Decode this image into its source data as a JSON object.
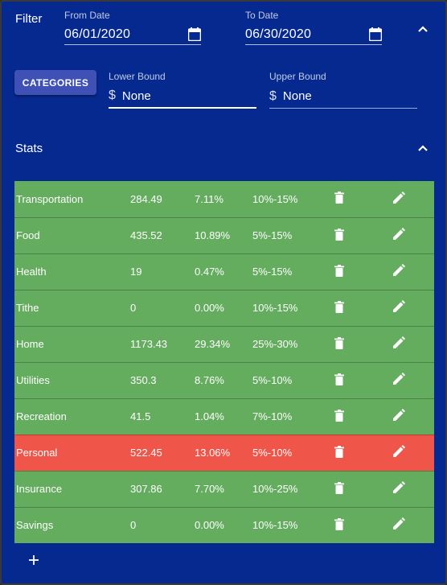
{
  "filter": {
    "title": "Filter",
    "from_date": {
      "label": "From Date",
      "value": "06/01/2020"
    },
    "to_date": {
      "label": "To Date",
      "value": "06/30/2020"
    },
    "categories_button": "CATEGORIES",
    "lower_bound": {
      "label": "Lower Bound",
      "prefix": "$",
      "value": "None"
    },
    "upper_bound": {
      "label": "Upper Bound",
      "prefix": "$",
      "value": "None"
    }
  },
  "stats": {
    "title": "Stats",
    "rows": [
      {
        "name": "Transportation",
        "amount": "284.49",
        "percent": "7.11%",
        "range": "10%-15%",
        "status": "ok"
      },
      {
        "name": "Food",
        "amount": "435.52",
        "percent": "10.89%",
        "range": "5%-15%",
        "status": "ok"
      },
      {
        "name": "Health",
        "amount": "19",
        "percent": "0.47%",
        "range": "5%-15%",
        "status": "ok"
      },
      {
        "name": "Tithe",
        "amount": "0",
        "percent": "0.00%",
        "range": "10%-15%",
        "status": "ok"
      },
      {
        "name": "Home",
        "amount": "1173.43",
        "percent": "29.34%",
        "range": "25%-30%",
        "status": "ok"
      },
      {
        "name": "Utilities",
        "amount": "350.3",
        "percent": "8.76%",
        "range": "5%-10%",
        "status": "ok"
      },
      {
        "name": "Recreation",
        "amount": "41.5",
        "percent": "1.04%",
        "range": "7%-10%",
        "status": "ok"
      },
      {
        "name": "Personal",
        "amount": "522.45",
        "percent": "13.06%",
        "range": "5%-10%",
        "status": "over"
      },
      {
        "name": "Insurance",
        "amount": "307.86",
        "percent": "7.70%",
        "range": "10%-25%",
        "status": "ok"
      },
      {
        "name": "Savings",
        "amount": "0",
        "percent": "0.00%",
        "range": "10%-15%",
        "status": "ok"
      }
    ]
  },
  "icons": {
    "collapse": "chevron-up-icon",
    "date_picker": "calendar-icon",
    "delete": "trash-icon",
    "edit": "pencil-icon",
    "add": "plus-icon"
  },
  "colors": {
    "background": "#06298f",
    "button": "#3f51b5",
    "row_ok": "#64ad5f",
    "row_over": "#f0554a"
  }
}
